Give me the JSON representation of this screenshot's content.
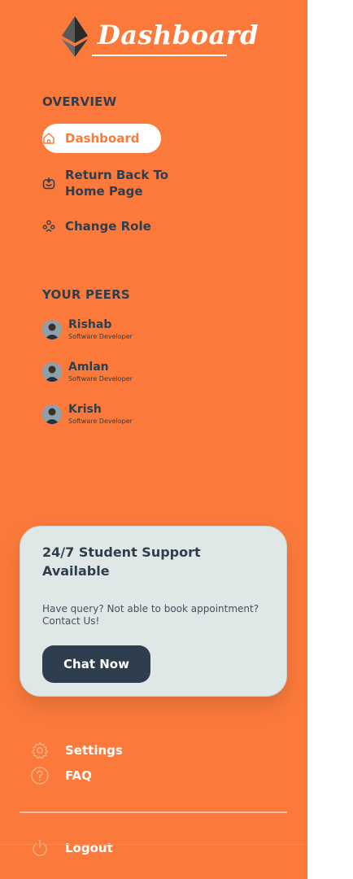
{
  "brand": {
    "title": "Dashboard",
    "icon": "ethereum-diamond-icon"
  },
  "colors": {
    "sidebar": "#FB7A3B",
    "text_dark": "#2F3E4E",
    "card": "#DFE8E6",
    "active_text": "#FB7A3B"
  },
  "overview": {
    "heading": "OVERVIEW",
    "items": [
      {
        "label": "Dashboard",
        "icon": "home-icon",
        "active": true
      },
      {
        "label": "Return Back To Home Page",
        "icon": "inbox-return-icon",
        "active": false
      },
      {
        "label": "Change Role",
        "icon": "users-group-icon",
        "active": false
      }
    ]
  },
  "peers": {
    "heading": "YOUR PEERS",
    "items": [
      {
        "name": "Rishab",
        "role": "Software Developer"
      },
      {
        "name": "Amlan",
        "role": "Software Developer"
      },
      {
        "name": "Krish",
        "role": "Software Developer"
      }
    ]
  },
  "support": {
    "title": "24/7 Student Support Available",
    "text": "Have query? Not able to book appointment? Contact Us!",
    "button": "Chat Now"
  },
  "bottom_menu": {
    "settings": "Settings",
    "faq": "FAQ",
    "logout": "Logout"
  }
}
